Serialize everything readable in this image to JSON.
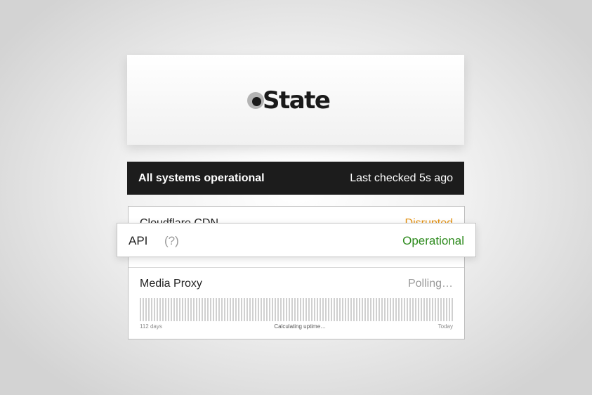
{
  "brand": {
    "logo_text": "State"
  },
  "status_bar": {
    "title": "All systems operational",
    "last_checked": "Last checked 5s ago"
  },
  "services": [
    {
      "name": "Cloudflare CDN",
      "status": "Disrupted",
      "status_color": "#e3900f"
    },
    {
      "name": "API",
      "help": "(?)",
      "status": "Operational",
      "status_color": "#2e8b1e"
    },
    {
      "name": "Media Proxy",
      "status": "Polling…",
      "status_color": "#9a9a9a",
      "uptime": {
        "start_label": "112 days",
        "middle_label": "Calculating uptime…",
        "end_label": "Today"
      }
    }
  ],
  "colors": {
    "status_bar_bg": "#1c1c1c",
    "operational": "#2e8b1e",
    "disrupted": "#e3900f"
  }
}
